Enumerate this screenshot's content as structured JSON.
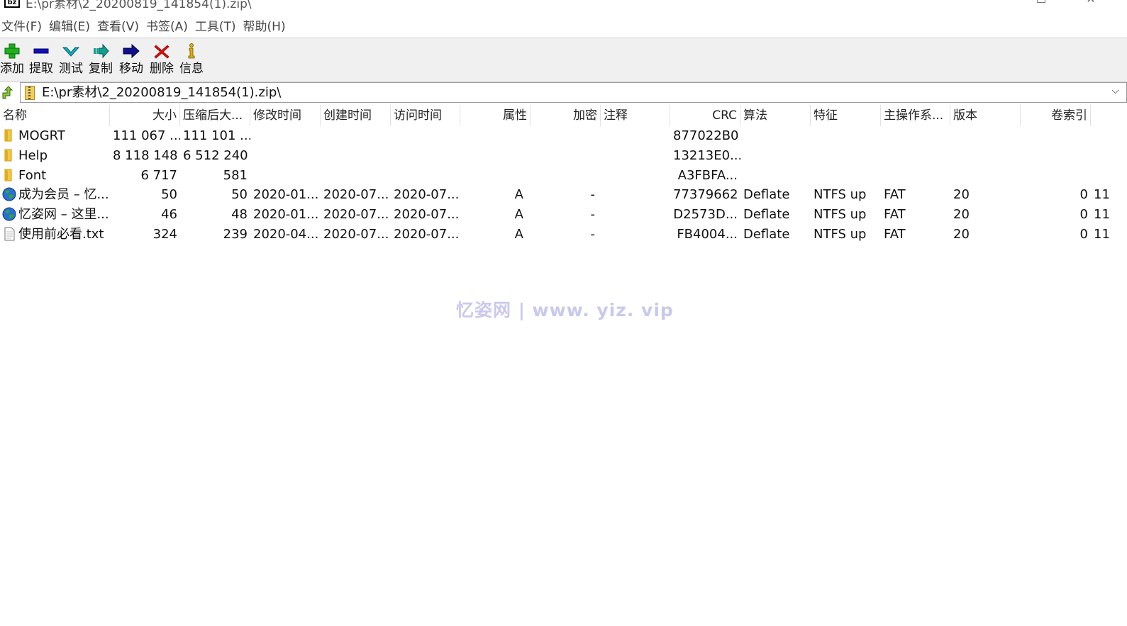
{
  "window": {
    "app_icon_text": "bz",
    "title": "E:\\pr素材\\2_20200819_141854(1).zip\\",
    "controls": [
      "—",
      "☐",
      "✕"
    ]
  },
  "menu": [
    "文件(F)",
    "编辑(E)",
    "查看(V)",
    "书签(A)",
    "工具(T)",
    "帮助(H)"
  ],
  "toolbar": {
    "buttons": [
      {
        "label": "添加",
        "icon": "plus-icon",
        "color": "#20b020"
      },
      {
        "label": "提取",
        "icon": "minus-icon",
        "color": "#1010c0"
      },
      {
        "label": "测试",
        "icon": "check-chevron-icon",
        "color": "#10a0b0"
      },
      {
        "label": "复制",
        "icon": "copy-arrow-icon",
        "color": "#10a090"
      },
      {
        "label": "移动",
        "icon": "move-arrow-icon",
        "color": "#10108a"
      },
      {
        "label": "删除",
        "icon": "x-icon",
        "color": "#e01010"
      },
      {
        "label": "信息",
        "icon": "info-icon",
        "color": "#e0b000"
      }
    ]
  },
  "address": {
    "path": "E:\\pr素材\\2_20200819_141854(1).zip\\",
    "dropdown": "⌵"
  },
  "columns": [
    "名称",
    "大小",
    "压缩后大...",
    "修改时间",
    "创建时间",
    "访问时间",
    "属性",
    "加密",
    "注释",
    "CRC",
    "算法",
    "特征",
    "主操作系...",
    "版本",
    "卷索引"
  ],
  "rows": [
    {
      "type": "folder",
      "name": "MOGRT",
      "size": "111 067 ...",
      "packed": "111 101 ...",
      "modified": "",
      "created": "",
      "accessed": "",
      "attr": "",
      "enc": "",
      "comment": "",
      "crc": "877022B0",
      "method": "",
      "chars": "",
      "host": "",
      "ver": "",
      "vol": "",
      "extra": ""
    },
    {
      "type": "folder",
      "name": "Help",
      "size": "8 118 148",
      "packed": "6 512 240",
      "modified": "",
      "created": "",
      "accessed": "",
      "attr": "",
      "enc": "",
      "comment": "",
      "crc": "13213E0...",
      "method": "",
      "chars": "",
      "host": "",
      "ver": "",
      "vol": "",
      "extra": ""
    },
    {
      "type": "folder",
      "name": "Font",
      "size": "6 717",
      "packed": "581",
      "modified": "",
      "created": "",
      "accessed": "",
      "attr": "",
      "enc": "",
      "comment": "",
      "crc": "A3FBFA...",
      "method": "",
      "chars": "",
      "host": "",
      "ver": "",
      "vol": "",
      "extra": ""
    },
    {
      "type": "web",
      "name": "成为会员 – 忆...",
      "size": "50",
      "packed": "50",
      "modified": "2020-01...",
      "created": "2020-07...",
      "accessed": "2020-07...",
      "attr": "A",
      "enc": "-",
      "comment": "",
      "crc": "77379662",
      "method": "Deflate",
      "chars": "NTFS up",
      "host": "FAT",
      "ver": "20",
      "vol": "0",
      "extra": "11"
    },
    {
      "type": "web",
      "name": "忆姿网 – 这里...",
      "size": "46",
      "packed": "48",
      "modified": "2020-01...",
      "created": "2020-07...",
      "accessed": "2020-07...",
      "attr": "A",
      "enc": "-",
      "comment": "",
      "crc": "D2573D...",
      "method": "Deflate",
      "chars": "NTFS up",
      "host": "FAT",
      "ver": "20",
      "vol": "0",
      "extra": "11"
    },
    {
      "type": "text",
      "name": "使用前必看.txt",
      "size": "324",
      "packed": "239",
      "modified": "2020-04...",
      "created": "2020-07...",
      "accessed": "2020-07...",
      "attr": "A",
      "enc": "-",
      "comment": "",
      "crc": "FB4004...",
      "method": "Deflate",
      "chars": "NTFS up",
      "host": "FAT",
      "ver": "20",
      "vol": "0",
      "extra": "11"
    }
  ],
  "watermark": "忆姿网 | www. yiz. vip"
}
